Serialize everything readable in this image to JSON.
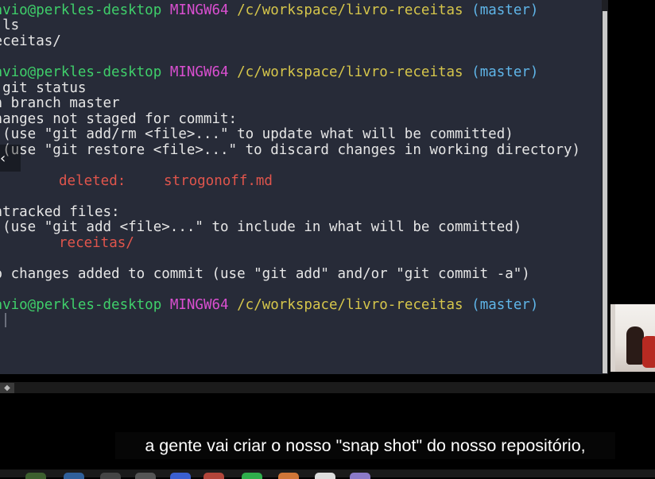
{
  "terminal": {
    "lines": [
      {
        "user": "tavio@perkles-desktop",
        "msystem": "MINGW64",
        "path": "/c/workspace/livro-receitas",
        "branch": "(master)"
      },
      {
        "text": "  ls"
      },
      {
        "text": "receitas/"
      },
      {
        "user": "tavio@perkles-desktop",
        "msystem": "MINGW64",
        "path": "/c/workspace/livro-receitas",
        "branch": "(master)"
      },
      {
        "text": "  git status"
      },
      {
        "text": "On branch master"
      },
      {
        "text": "Changes not staged for commit:"
      },
      {
        "text": "  (use \"git add/rm <file>...\" to update what will be committed)"
      },
      {
        "text": "  (use \"git restore <file>...\" to discard changes in working directory)"
      },
      {
        "deleted_label": "deleted:",
        "deleted_file": "strogonoff.md"
      },
      {
        "text": "Untracked files:"
      },
      {
        "text": "  (use \"git add <file>...\" to include in what will be committed)"
      },
      {
        "untracked_file": "receitas/"
      },
      {
        "text": "no changes added to commit (use \"git add\" and/or \"git commit -a\")"
      },
      {
        "user": "tavio@perkles-desktop",
        "msystem": "MINGW64",
        "path": "/c/workspace/livro-receitas",
        "branch": "(master)"
      }
    ]
  },
  "nav": {
    "back_icon": "chevron-left-icon",
    "back_glyph": "‹"
  },
  "subtitle": {
    "text": "a gente vai criar o nosso \"snap shot\" do nosso repositório,"
  },
  "colors": {
    "terminal_bg": "#272b38",
    "user": "#3fcf6a",
    "msystem": "#d94fd0",
    "path": "#d6c64b",
    "branch": "#5fb5e8",
    "deleted": "#e0554c"
  }
}
